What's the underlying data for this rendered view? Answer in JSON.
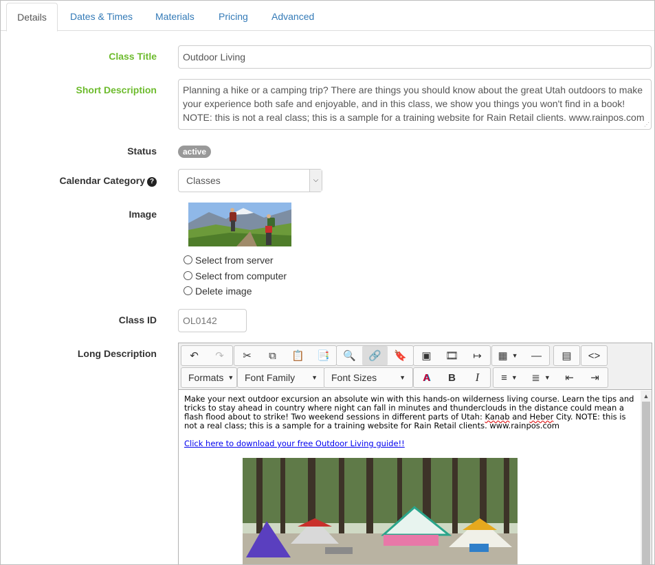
{
  "tabs": [
    {
      "label": "Details",
      "active": true
    },
    {
      "label": "Dates & Times"
    },
    {
      "label": "Materials"
    },
    {
      "label": "Pricing"
    },
    {
      "label": "Advanced"
    }
  ],
  "form": {
    "class_title_label": "Class Title",
    "class_title_value": "Outdoor Living",
    "short_desc_label": "Short Description",
    "short_desc_value": "Planning a hike or a camping trip? There are things you should know about the great Utah outdoors to make your experience both safe and enjoyable, and in this class, we show you things you won't find in a book! NOTE: this is not a real class; this is a sample for a training website for Rain Retail clients. www.rainpos.com",
    "status_label": "Status",
    "status_value": "active",
    "calendar_label": "Calendar Category",
    "calendar_value": "Classes",
    "image_label": "Image",
    "image_options": [
      "Select from server",
      "Select from computer",
      "Delete image"
    ],
    "class_id_label": "Class ID",
    "class_id_value": "OL0142",
    "long_desc_label": "Long Description"
  },
  "editor": {
    "formats_label": "Formats",
    "font_family_label": "Font Family",
    "font_sizes_label": "Font Sizes",
    "body_part1": "Make your next outdoor excursion an absolute win with this hands-on wilderness living course. Learn the tips and tricks to stay ahead in country where night can fall in minutes and thunderclouds in the distance could mean a flash flood about to strike! Two weekend sessions in different parts of Utah: ",
    "body_kanab": "Kanab",
    "body_and": " and ",
    "body_heber": "Heber",
    "body_part2": " City. NOTE: this is not a real class; this is a sample for a training website for Rain Retail clients. www.rainpos.com",
    "link_text": "Click here to download your free Outdoor Living guide!!"
  },
  "colors": {
    "accent_link": "#337ab7",
    "label_green": "#6dbb2d",
    "badge_gray": "#999999"
  }
}
